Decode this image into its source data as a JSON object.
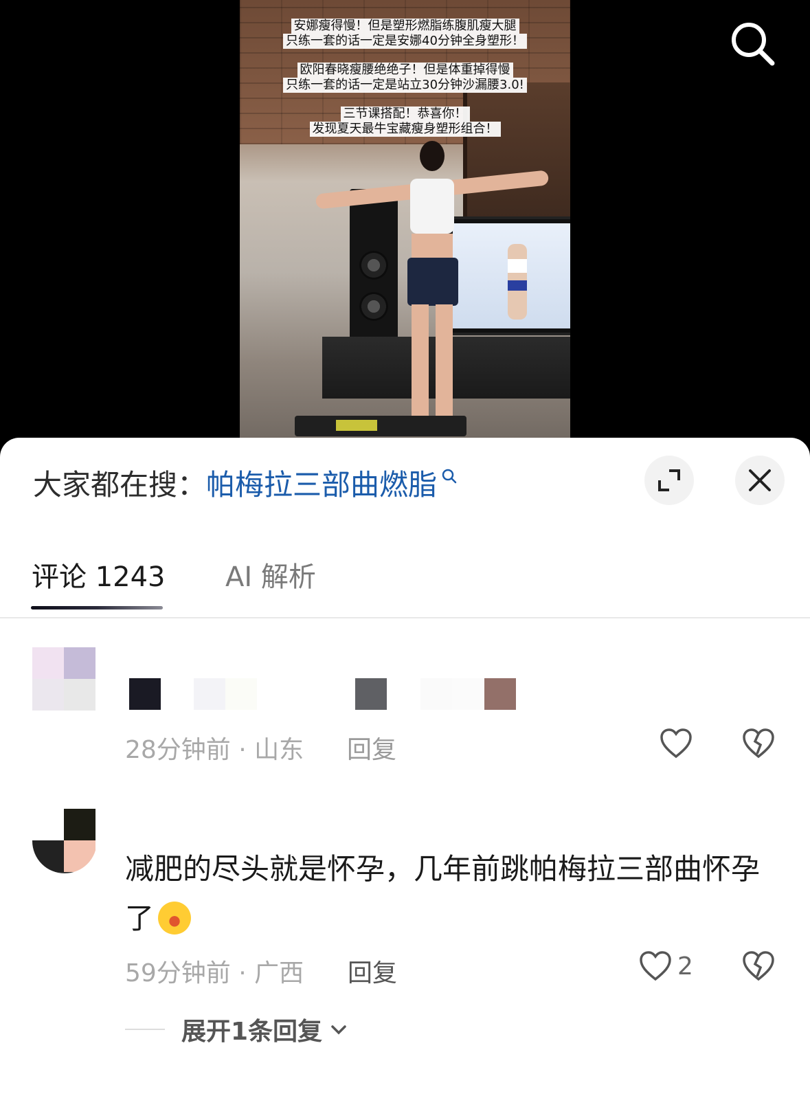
{
  "video": {
    "captions": [
      "安娜瘦得慢！但是塑形燃脂练腹肌瘦大腿",
      "只练一套的话一定是安娜40分钟全身塑形！",
      "欧阳春晓瘦腰绝绝子！但是体重掉得慢",
      "只练一套的话一定是站立30分钟沙漏腰3.0!",
      "三节课搭配！恭喜你！",
      "发现夏天最牛宝藏瘦身塑形组合！"
    ],
    "search_icon": "search-icon"
  },
  "sheet": {
    "hot_search_prefix": "大家都在搜：",
    "hot_search_term": "帕梅拉三部曲燃脂",
    "expand_icon": "expand-icon",
    "close_icon": "close-icon"
  },
  "tabs": {
    "comments_label": "评论 1243",
    "ai_label": "AI 解析",
    "active": "comments"
  },
  "comments": [
    {
      "meta": "28分钟前 · 山东",
      "reply_label": "回复",
      "likes": ""
    },
    {
      "text": "减肥的尽头就是怀孕，几年前跳帕梅拉三部曲怀孕了",
      "emoji": "laughing-crying-emoji",
      "meta": "59分钟前 · 广西",
      "reply_label": "回复",
      "likes": "2",
      "expand_label": "展开1条回复"
    }
  ],
  "colors": {
    "link_blue": "#1b5cab",
    "meta_gray": "#a8a8a8",
    "sheet_bg": "#ffffff"
  }
}
